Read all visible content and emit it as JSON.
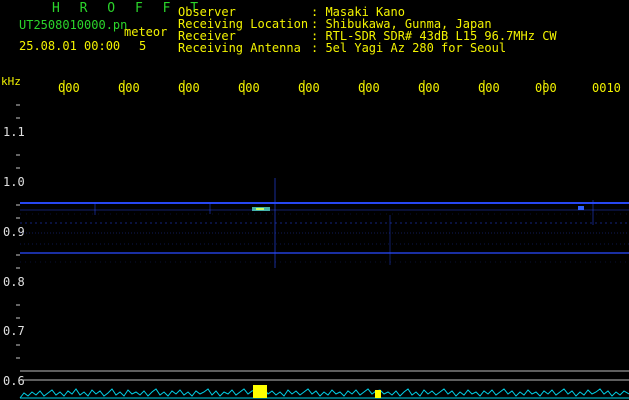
{
  "header": {
    "brand": "H R O F F T",
    "filename": "UT2508010000.pn",
    "meteor_label": "meteor",
    "datetime": "25.08.01 00:00",
    "meteor_count": "5"
  },
  "meta": [
    {
      "key": "Observer",
      "value": ": Masaki Kano"
    },
    {
      "key": "Receiving Location",
      "value": ": Shibukawa, Gunma, Japan"
    },
    {
      "key": "Receiver",
      "value": ": RTL-SDR SDR# 43dB L15 96.7MHz CW"
    },
    {
      "key": "Receiving Antenna",
      "value": ": 5el Yagi Az 280 for Seoul"
    }
  ],
  "axis": {
    "unit": "kHz",
    "y_labels": [
      "1.1",
      "1.0",
      "0.9",
      "0.8",
      "0.7",
      "0.6"
    ],
    "x_labels": [
      "000",
      "000",
      "000",
      "000",
      "000",
      "000",
      "000",
      "000",
      "000",
      "0010"
    ]
  },
  "colors": {
    "green": "#2bd52b",
    "yellow": "#f3f300",
    "trace": "#2a4bff",
    "histogram": "#00cfe6",
    "meteor_bar": "#ffff00"
  }
}
